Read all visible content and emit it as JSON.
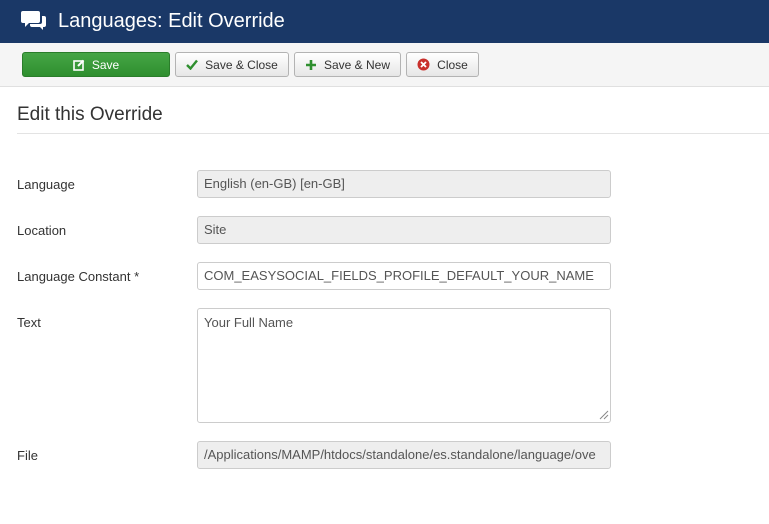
{
  "header": {
    "title": "Languages: Edit Override",
    "icon": "comments-icon",
    "background_color": "#1a3867"
  },
  "toolbar": {
    "save_label": "Save",
    "save_close_label": "Save & Close",
    "save_new_label": "Save & New",
    "close_label": "Close",
    "save_color": "#46a546",
    "close_icon_color": "#c9302c"
  },
  "page": {
    "title": "Edit this Override"
  },
  "form": {
    "language_label": "Language",
    "language_value": "English (en-GB) [en-GB]",
    "location_label": "Location",
    "location_value": "Site",
    "constant_label": "Language Constant *",
    "constant_value": "COM_EASYSOCIAL_FIELDS_PROFILE_DEFAULT_YOUR_NAME",
    "text_label": "Text",
    "text_value": "Your Full Name",
    "file_label": "File",
    "file_value": "/Applications/MAMP/htdocs/standalone/es.standalone/language/ove"
  }
}
